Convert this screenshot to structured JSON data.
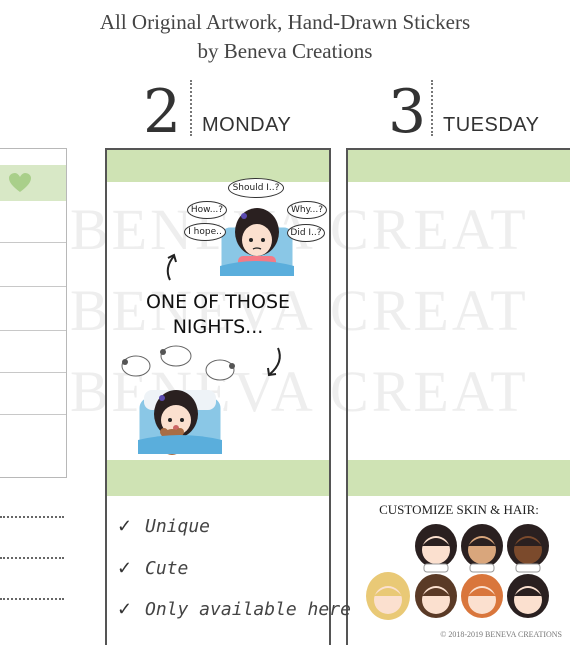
{
  "header": {
    "line1": "All Original Artwork, Hand-Drawn Stickers",
    "line2": "by Beneva Creations"
  },
  "watermark": [
    "BENEVA CREAT",
    "BENEVA CREAT",
    "BENEVA CREAT"
  ],
  "days": [
    {
      "number": "2",
      "name": "MONDAY"
    },
    {
      "number": "3",
      "name": "TUESDAY"
    }
  ],
  "thought_bubbles": [
    "Should I..?",
    "How...?",
    "Why...?",
    "I hope..",
    "Did I..?"
  ],
  "caption": {
    "line1": "ONE OF THOSE",
    "line2": "NIGHTS..."
  },
  "features": [
    "Unique",
    "Cute",
    "Only available here"
  ],
  "customize": "CUSTOMIZE SKIN & HAIR:",
  "copyright": "© 2018-2019 BENEVA CREATIONS",
  "colors": {
    "green_band": "#cfe3b4",
    "border": "#555555",
    "pillow": "#8ac7e6",
    "hair": "#2a2020"
  },
  "icons": [
    "heart-icon",
    "check-icon",
    "arrow-icon"
  ]
}
